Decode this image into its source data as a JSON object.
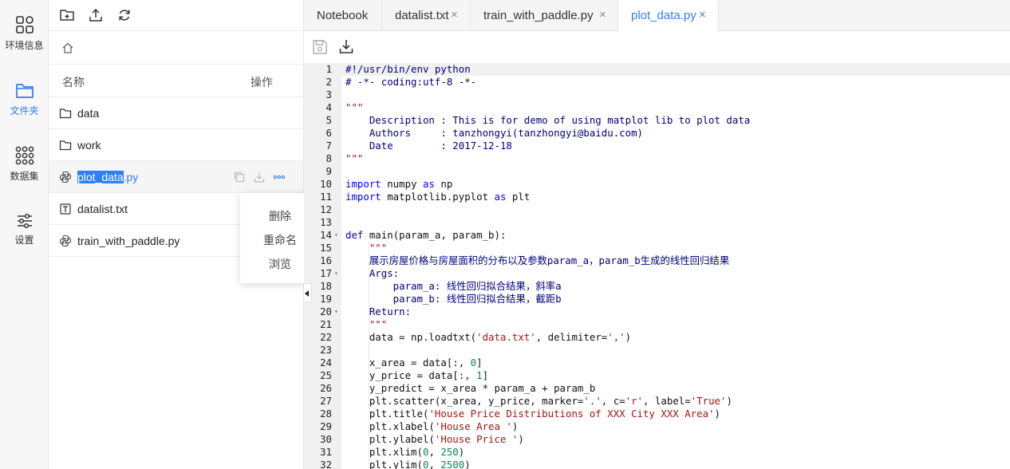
{
  "rail": {
    "items": [
      {
        "label": "环境信息",
        "icon": "grid-icon"
      },
      {
        "label": "文件夹",
        "icon": "folder-icon"
      },
      {
        "label": "数据集",
        "icon": "dataset-icon"
      },
      {
        "label": "设置",
        "icon": "settings-icon"
      }
    ],
    "accent": "#2f7ef5"
  },
  "files": {
    "header": {
      "name": "名称",
      "ops": "操作"
    },
    "rows": [
      {
        "name": "data",
        "icon": "folder-icon"
      },
      {
        "name": "work",
        "icon": "folder-icon"
      },
      {
        "name_sel": "plot_data",
        "name_rest": ".py",
        "icon": "python-icon"
      },
      {
        "name": "datalist.txt",
        "icon": "text-file-icon"
      },
      {
        "name": "train_with_paddle.py",
        "icon": "python-icon"
      }
    ],
    "menu": [
      "删除",
      "重命名",
      "浏览"
    ]
  },
  "tabs": [
    {
      "label": "Notebook"
    },
    {
      "label": "datalist.txt",
      "close": "×"
    },
    {
      "label": "train_with_paddle.py",
      "close": "×"
    },
    {
      "label": "plot_data.py",
      "close": "×"
    }
  ],
  "code": {
    "lines": [
      [
        [
          "c",
          "#!/usr/bin/env python"
        ]
      ],
      [
        [
          "c",
          "# -*- coding:utf-8 -*-"
        ]
      ],
      [],
      [
        [
          "s",
          "\"\"\""
        ]
      ],
      [
        [
          "c",
          "    Description : This is for demo of using matplot lib to plot data"
        ]
      ],
      [
        [
          "c",
          "    Authors     : tanzhongyi(tanzhongyi@baidu.com)"
        ]
      ],
      [
        [
          "c",
          "    Date        : 2017-12-18"
        ]
      ],
      [
        [
          "s",
          "\"\"\""
        ]
      ],
      [],
      [
        [
          "k",
          "import"
        ],
        [
          "t",
          " numpy "
        ],
        [
          "k",
          "as"
        ],
        [
          "t",
          " np"
        ]
      ],
      [
        [
          "k",
          "import"
        ],
        [
          "t",
          " matplotlib.pyplot "
        ],
        [
          "k",
          "as"
        ],
        [
          "t",
          " plt"
        ]
      ],
      [],
      [],
      [
        [
          "k",
          "def"
        ],
        [
          "t",
          " main(param_a, param_b):"
        ]
      ],
      [
        [
          "s",
          "    \"\"\""
        ]
      ],
      [
        [
          "c",
          "    展示房屋价格与房屋面积的分布以及参数param_a，param_b生成的线性回归结果"
        ]
      ],
      [
        [
          "c",
          "    Args:"
        ]
      ],
      [
        [
          "c",
          "        param_a: 线性回归拟合结果，斜率a"
        ]
      ],
      [
        [
          "c",
          "        param_b: 线性回归拟合结果，截距b"
        ]
      ],
      [
        [
          "c",
          "    Return:"
        ]
      ],
      [
        [
          "s",
          "    \"\"\""
        ]
      ],
      [
        [
          "t",
          "    data = np.loadtxt("
        ],
        [
          "s",
          "'data.txt'"
        ],
        [
          "t",
          ", delimiter="
        ],
        [
          "s",
          "','"
        ],
        [
          "t",
          ")"
        ]
      ],
      [],
      [
        [
          "t",
          "    x_area = data[:, "
        ],
        [
          "n",
          "0"
        ],
        [
          "t",
          "]"
        ]
      ],
      [
        [
          "t",
          "    y_price = data[:, "
        ],
        [
          "n",
          "1"
        ],
        [
          "t",
          "]"
        ]
      ],
      [
        [
          "t",
          "    y_predict = x_area * param_a + param_b"
        ]
      ],
      [
        [
          "t",
          "    plt.scatter(x_area, y_price, marker="
        ],
        [
          "s",
          "'.'"
        ],
        [
          "t",
          ", c="
        ],
        [
          "s",
          "'r'"
        ],
        [
          "t",
          ", label="
        ],
        [
          "s",
          "'True'"
        ],
        [
          "t",
          ")"
        ]
      ],
      [
        [
          "t",
          "    plt.title("
        ],
        [
          "s",
          "'House Price Distributions of XXX City XXX Area'"
        ],
        [
          "t",
          ")"
        ]
      ],
      [
        [
          "t",
          "    plt.xlabel("
        ],
        [
          "s",
          "'House Area '"
        ],
        [
          "t",
          ")"
        ]
      ],
      [
        [
          "t",
          "    plt.ylabel("
        ],
        [
          "s",
          "'House Price '"
        ],
        [
          "t",
          ")"
        ]
      ],
      [
        [
          "t",
          "    plt.xlim("
        ],
        [
          "n",
          "0"
        ],
        [
          "t",
          ", "
        ],
        [
          "n",
          "250"
        ],
        [
          "t",
          ")"
        ]
      ],
      [
        [
          "t",
          "    plt.ylim("
        ],
        [
          "n",
          "0"
        ],
        [
          "t",
          ", "
        ],
        [
          "n",
          "2500"
        ],
        [
          "t",
          ")"
        ]
      ]
    ],
    "line_numbers": [
      "1",
      "2",
      "3",
      "4",
      "5",
      "6",
      "7",
      "8",
      "9",
      "10",
      "11",
      "12",
      "13",
      "14",
      "15",
      "16",
      "17",
      "18",
      "19",
      "20",
      "21",
      "22",
      "23",
      "24",
      "25",
      "26",
      "27",
      "28",
      "29",
      "30",
      "31",
      "32"
    ],
    "fold_lines": [
      14,
      17,
      20
    ]
  }
}
